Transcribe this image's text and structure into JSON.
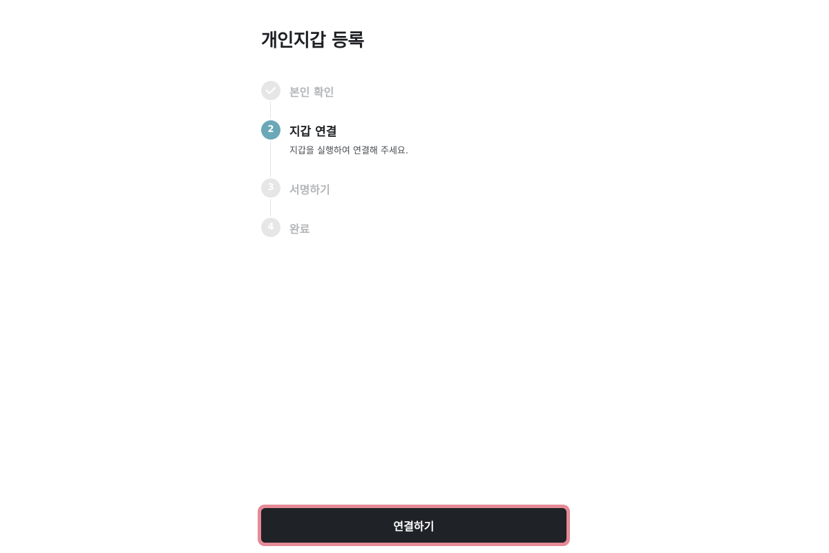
{
  "page": {
    "title": "개인지갑 등록"
  },
  "steps": [
    {
      "number": "",
      "label": "본인 확인",
      "state": "done",
      "icon": "check-icon"
    },
    {
      "number": "2",
      "label": "지갑 연결",
      "state": "active",
      "description": "지갑을 실행하여 연결해 주세요."
    },
    {
      "number": "3",
      "label": "서명하기",
      "state": "pending"
    },
    {
      "number": "4",
      "label": "완료",
      "state": "pending"
    }
  ],
  "cta": {
    "label": "연결하기"
  },
  "colors": {
    "active": "#6aa8b7",
    "inactive": "#e6e6e6",
    "button": "#1f2227",
    "focus_ring": "#e58a96"
  }
}
